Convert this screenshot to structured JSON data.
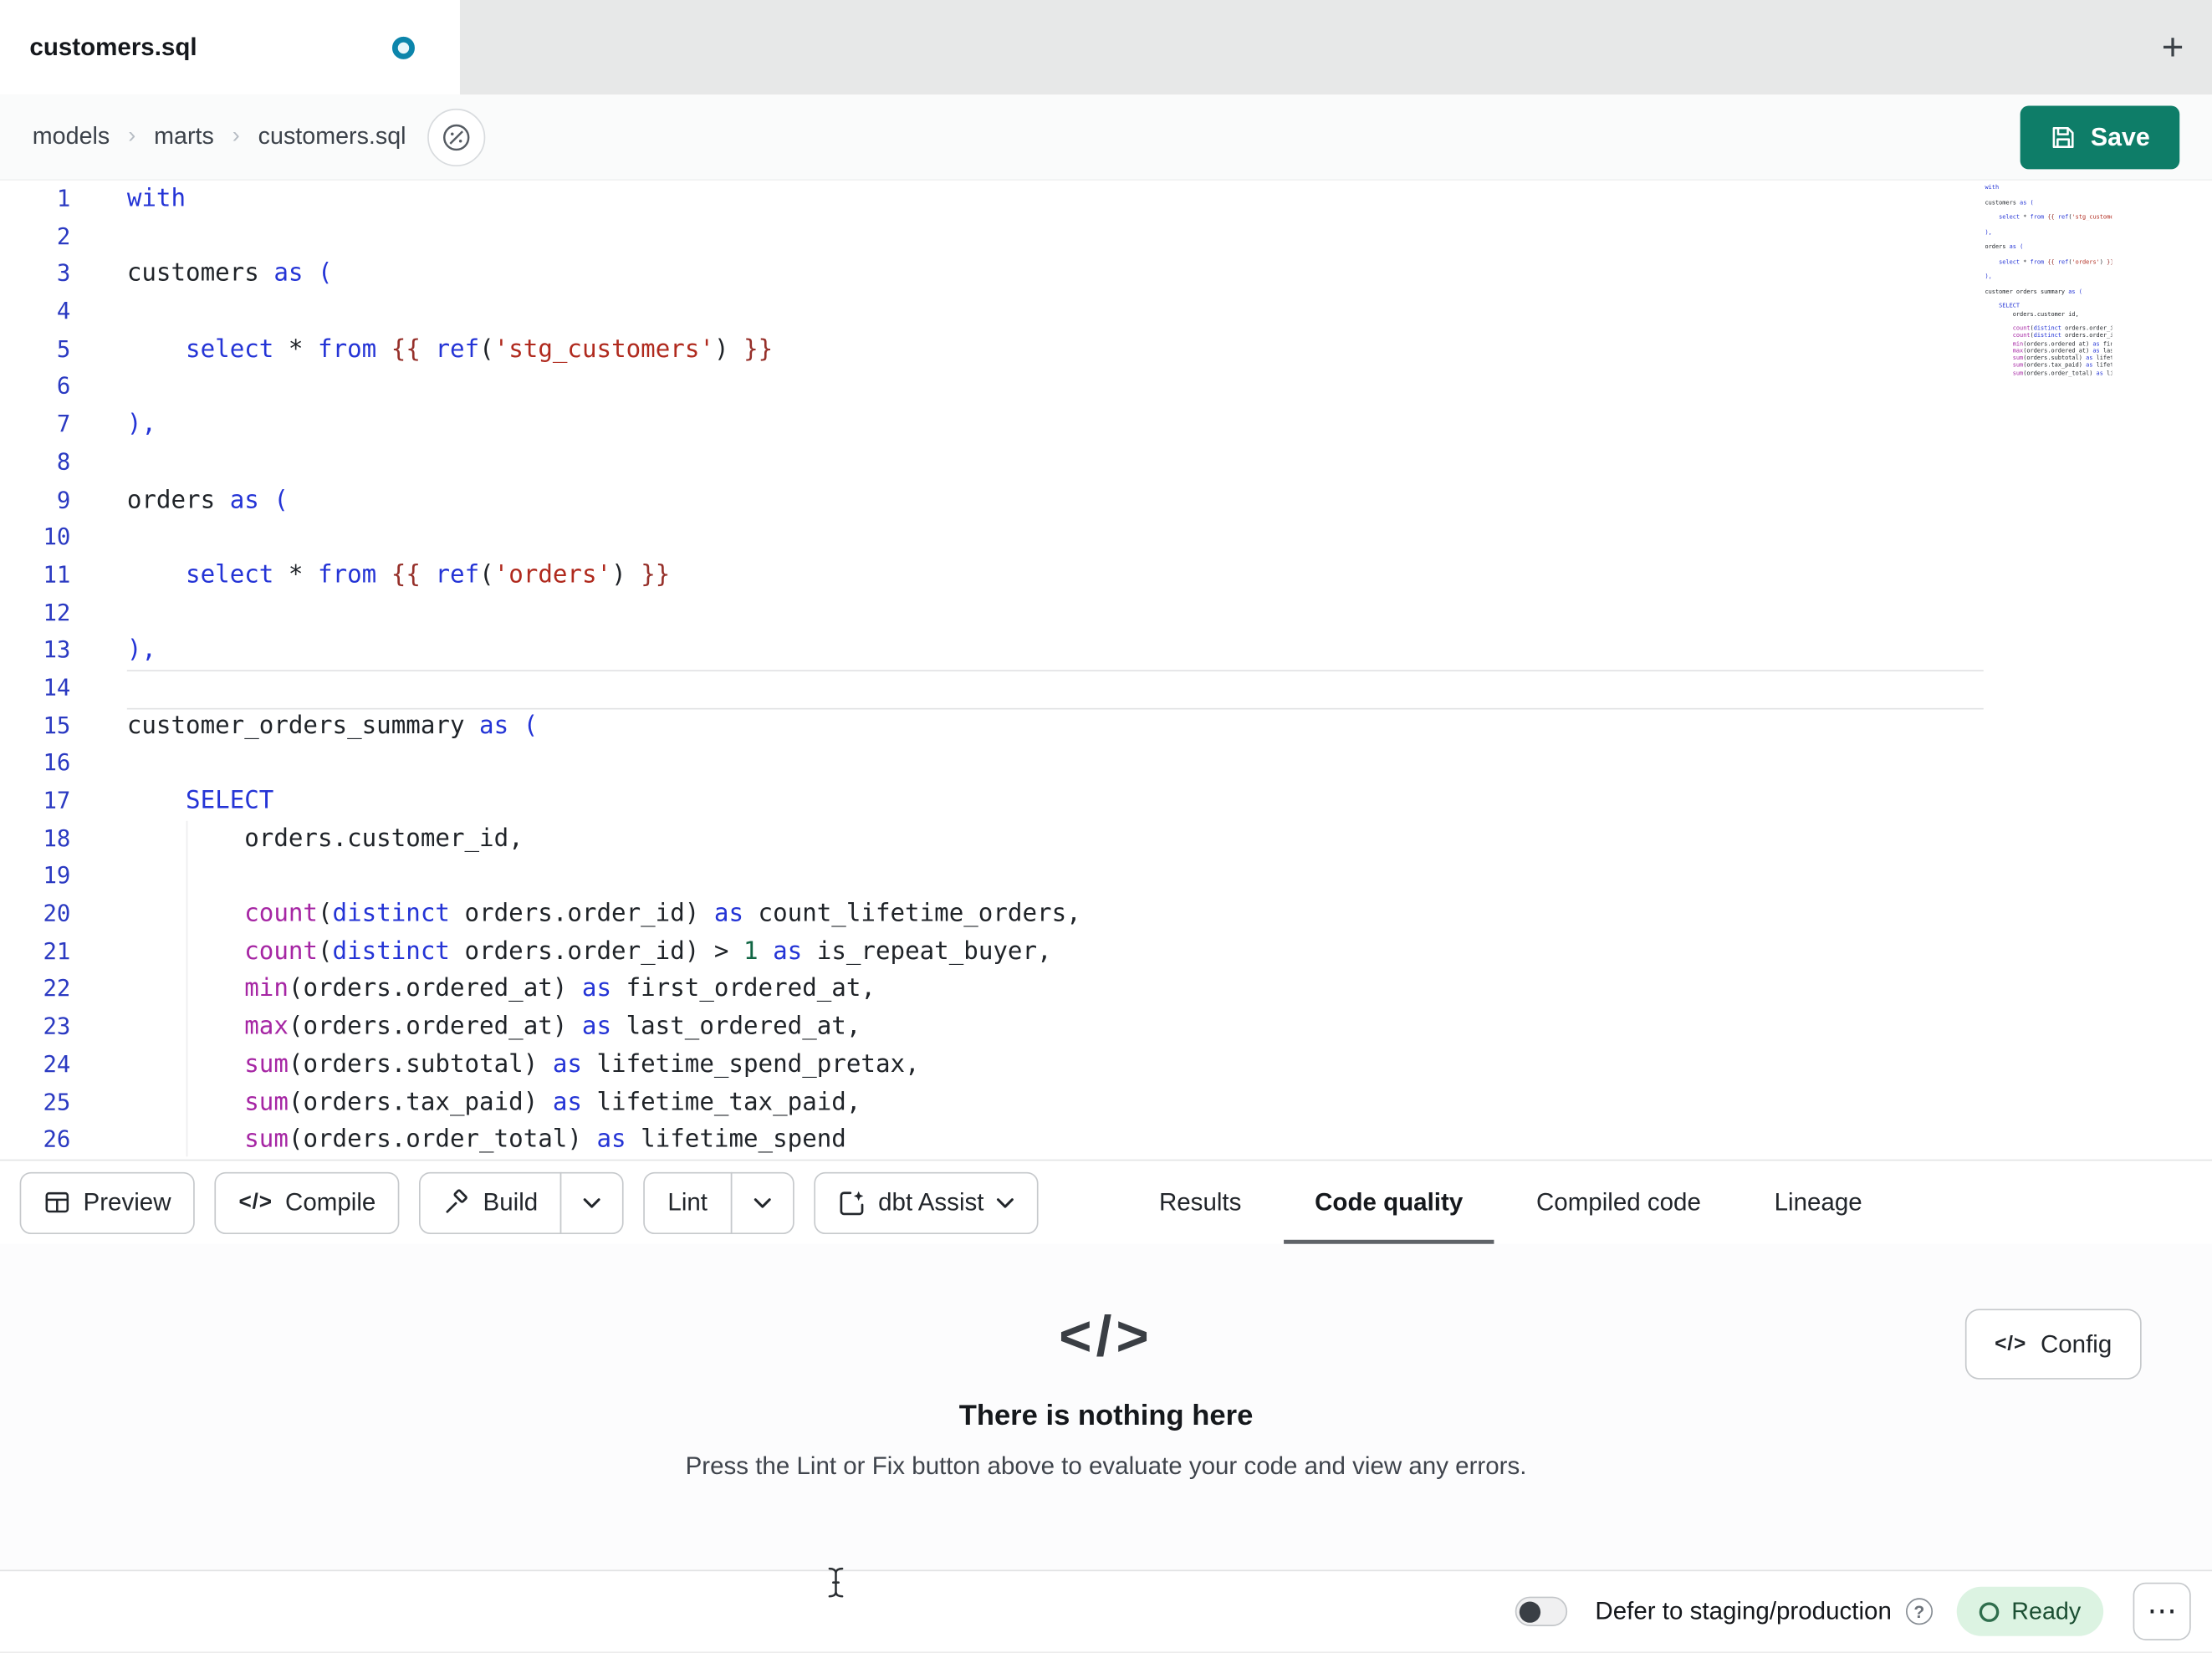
{
  "window_title": "customers.sql",
  "tab_bar": {
    "active_tab_label": "customers.sql",
    "new_tab_glyph": "+"
  },
  "breadcrumb": {
    "items": [
      "models",
      "marts",
      "customers.sql"
    ],
    "separator": "›"
  },
  "save_button": {
    "label": "Save"
  },
  "editor": {
    "active_line": 14,
    "lines": [
      {
        "no": 1,
        "tokens": [
          [
            "kw",
            "with"
          ]
        ]
      },
      {
        "no": 2,
        "tokens": []
      },
      {
        "no": 3,
        "tokens": [
          [
            "plain",
            "customers "
          ],
          [
            "kw",
            "as"
          ],
          [
            "plain",
            " "
          ],
          [
            "br",
            "("
          ]
        ]
      },
      {
        "no": 4,
        "tokens": []
      },
      {
        "no": 5,
        "tokens": [
          [
            "plain",
            "    "
          ],
          [
            "kw",
            "select"
          ],
          [
            "plain",
            " * "
          ],
          [
            "kw",
            "from"
          ],
          [
            "plain",
            " "
          ],
          [
            "jinja",
            "{{ "
          ],
          [
            "kw",
            "ref"
          ],
          [
            "plain",
            "("
          ],
          [
            "str",
            "'stg_customers'"
          ],
          [
            "plain",
            ") "
          ],
          [
            "jinja",
            "}}"
          ]
        ]
      },
      {
        "no": 6,
        "tokens": []
      },
      {
        "no": 7,
        "tokens": [
          [
            "br",
            "),"
          ]
        ]
      },
      {
        "no": 8,
        "tokens": []
      },
      {
        "no": 9,
        "tokens": [
          [
            "plain",
            "orders "
          ],
          [
            "kw",
            "as"
          ],
          [
            "plain",
            " "
          ],
          [
            "br",
            "("
          ]
        ]
      },
      {
        "no": 10,
        "tokens": []
      },
      {
        "no": 11,
        "tokens": [
          [
            "plain",
            "    "
          ],
          [
            "kw",
            "select"
          ],
          [
            "plain",
            " * "
          ],
          [
            "kw",
            "from"
          ],
          [
            "plain",
            " "
          ],
          [
            "jinja",
            "{{ "
          ],
          [
            "kw",
            "ref"
          ],
          [
            "plain",
            "("
          ],
          [
            "str",
            "'orders'"
          ],
          [
            "plain",
            ") "
          ],
          [
            "jinja",
            "}}"
          ]
        ]
      },
      {
        "no": 12,
        "tokens": []
      },
      {
        "no": 13,
        "tokens": [
          [
            "br",
            "),"
          ]
        ]
      },
      {
        "no": 14,
        "tokens": []
      },
      {
        "no": 15,
        "tokens": [
          [
            "plain",
            "customer_orders_summary "
          ],
          [
            "kw",
            "as"
          ],
          [
            "plain",
            " "
          ],
          [
            "br",
            "("
          ]
        ]
      },
      {
        "no": 16,
        "tokens": []
      },
      {
        "no": 17,
        "tokens": [
          [
            "plain",
            "    "
          ],
          [
            "kw",
            "SELECT"
          ]
        ]
      },
      {
        "no": 18,
        "tokens": [
          [
            "plain",
            "        orders.customer_id,"
          ]
        ]
      },
      {
        "no": 19,
        "tokens": []
      },
      {
        "no": 20,
        "tokens": [
          [
            "plain",
            "        "
          ],
          [
            "fn",
            "count"
          ],
          [
            "plain",
            "("
          ],
          [
            "kw",
            "distinct"
          ],
          [
            "plain",
            " orders.order_id) "
          ],
          [
            "kw",
            "as"
          ],
          [
            "plain",
            " count_lifetime_orders,"
          ]
        ]
      },
      {
        "no": 21,
        "tokens": [
          [
            "plain",
            "        "
          ],
          [
            "fn",
            "count"
          ],
          [
            "plain",
            "("
          ],
          [
            "kw",
            "distinct"
          ],
          [
            "plain",
            " orders.order_id) > "
          ],
          [
            "num",
            "1"
          ],
          [
            "plain",
            " "
          ],
          [
            "kw",
            "as"
          ],
          [
            "plain",
            " is_repeat_buyer,"
          ]
        ]
      },
      {
        "no": 22,
        "tokens": [
          [
            "plain",
            "        "
          ],
          [
            "fn",
            "min"
          ],
          [
            "plain",
            "(orders.ordered_at) "
          ],
          [
            "kw",
            "as"
          ],
          [
            "plain",
            " first_ordered_at,"
          ]
        ]
      },
      {
        "no": 23,
        "tokens": [
          [
            "plain",
            "        "
          ],
          [
            "fn",
            "max"
          ],
          [
            "plain",
            "(orders.ordered_at) "
          ],
          [
            "kw",
            "as"
          ],
          [
            "plain",
            " last_ordered_at,"
          ]
        ]
      },
      {
        "no": 24,
        "tokens": [
          [
            "plain",
            "        "
          ],
          [
            "fn",
            "sum"
          ],
          [
            "plain",
            "(orders.subtotal) "
          ],
          [
            "kw",
            "as"
          ],
          [
            "plain",
            " lifetime_spend_pretax,"
          ]
        ]
      },
      {
        "no": 25,
        "tokens": [
          [
            "plain",
            "        "
          ],
          [
            "fn",
            "sum"
          ],
          [
            "plain",
            "(orders.tax_paid) "
          ],
          [
            "kw",
            "as"
          ],
          [
            "plain",
            " lifetime_tax_paid,"
          ]
        ]
      },
      {
        "no": 26,
        "tokens": [
          [
            "plain",
            "        "
          ],
          [
            "fn",
            "sum"
          ],
          [
            "plain",
            "(orders.order_total) "
          ],
          [
            "kw",
            "as"
          ],
          [
            "plain",
            " lifetime_spend"
          ]
        ]
      }
    ]
  },
  "toolbar": {
    "buttons": [
      {
        "id": "preview",
        "label": "Preview",
        "icon": "table-icon",
        "split": false,
        "chevron": false
      },
      {
        "id": "compile",
        "label": "Compile",
        "icon": "code-icon",
        "split": false,
        "chevron": false
      },
      {
        "id": "build",
        "label": "Build",
        "icon": "hammer-icon",
        "split": true,
        "chevron": true
      },
      {
        "id": "lint",
        "label": "Lint",
        "icon": null,
        "split": true,
        "chevron": true
      },
      {
        "id": "dbt-assist",
        "label": "dbt Assist",
        "icon": "assist-icon",
        "split": false,
        "chevron": true
      }
    ],
    "tabs": [
      {
        "id": "results",
        "label": "Results",
        "active": false
      },
      {
        "id": "code-quality",
        "label": "Code quality",
        "active": true
      },
      {
        "id": "compiled-code",
        "label": "Compiled code",
        "active": false
      },
      {
        "id": "lineage",
        "label": "Lineage",
        "active": false
      }
    ]
  },
  "results_panel": {
    "icon_glyph": "</>",
    "title": "There is nothing here",
    "subtitle": "Press the Lint or Fix button above to evaluate your code and view any errors.",
    "config_button": {
      "label": "Config",
      "icon_glyph": "</>"
    }
  },
  "status_bar": {
    "defer_toggle": {
      "label": "Defer to staging/production",
      "on": false
    },
    "help_glyph": "?",
    "ready_badge": {
      "label": "Ready"
    },
    "overflow_menu_glyph": "⋯"
  },
  "colors": {
    "save_button_bg": "#0e7d68",
    "unsaved_dot": "#0c85ab",
    "ready_badge_bg": "#dcf3e2",
    "ready_badge_text": "#1c4f33",
    "syntax": {
      "keyword": "#2434d6",
      "function": "#a626a4",
      "string": "#b02a1e",
      "jinja": "#96302a",
      "number": "#116644",
      "text": "#1f2328",
      "bracket": "#2434d6",
      "line_number": "#2b3ac2"
    }
  }
}
